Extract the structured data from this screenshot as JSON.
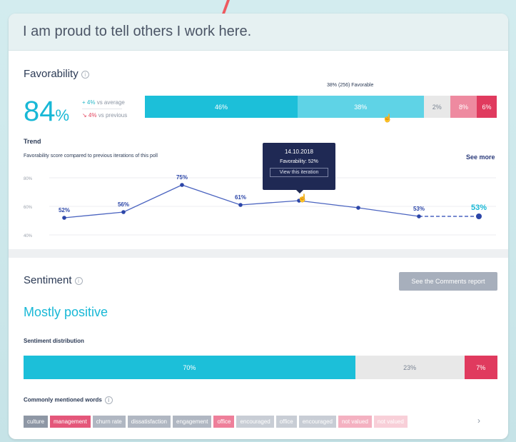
{
  "question": "I am proud to tell others I work here.",
  "favorability": {
    "title": "Favorability",
    "score": "84",
    "score_unit": "%",
    "vs_average": "+ 4%",
    "vs_average_label": "vs average",
    "vs_previous": "↘ 4%",
    "vs_previous_label": "vs previous",
    "bar_caption": "38% (256) Favorable",
    "segments": [
      {
        "label": "46%",
        "value": 46,
        "color": "#1cbfd9"
      },
      {
        "label": "38%",
        "value": 38,
        "color": "#5fd3e6"
      },
      {
        "label": "2%",
        "value": 8,
        "color": "#e8e8e8"
      },
      {
        "label": "8%",
        "value": 8,
        "color": "#ee8aa0"
      },
      {
        "label": "6%",
        "value": 6,
        "color": "#e03a5e"
      }
    ]
  },
  "trend": {
    "title": "Trend",
    "subtitle": "Favorability score compared to previous iterations of this poll",
    "see_more": "See more",
    "tooltip": {
      "date": "14.10.2018",
      "value": "Favorability: 52%",
      "action": "View this iteration"
    }
  },
  "chart_data": {
    "type": "line",
    "ylim": [
      35,
      85
    ],
    "yticks": [
      "80%",
      "60%",
      "40%"
    ],
    "ytick_values": [
      80,
      60,
      40
    ],
    "x": [
      0,
      1,
      2,
      3,
      4,
      5,
      6,
      7
    ],
    "values": [
      52,
      56,
      75,
      61,
      64,
      59,
      53,
      53
    ],
    "point_labels": [
      "52%",
      "56%",
      "75%",
      "61%",
      "",
      "",
      "53%",
      "53%"
    ],
    "projected_last": true,
    "line_color": "#4b64c0"
  },
  "sentiment": {
    "title": "Sentiment",
    "comments_button": "See the Comments report",
    "summary": "Mostly positive",
    "distribution_title": "Sentiment distribution",
    "segments": [
      {
        "label": "70%",
        "value": 70,
        "color": "#1cbfd9",
        "text_color": "#ffffff"
      },
      {
        "label": "23%",
        "value": 23,
        "color": "#e8e8e8",
        "text_color": "#7b8594"
      },
      {
        "label": "7%",
        "value": 7,
        "color": "#e03a5e",
        "text_color": "#ffffff"
      }
    ],
    "words_title": "Commonly mentioned words",
    "words": [
      {
        "text": "culture",
        "color": "#8e97a5"
      },
      {
        "text": "management",
        "color": "#e4577a"
      },
      {
        "text": "churn rate",
        "color": "#b0b7c2"
      },
      {
        "text": "dissatisfaction",
        "color": "#b0b7c2"
      },
      {
        "text": "engagement",
        "color": "#b0b7c2"
      },
      {
        "text": "office",
        "color": "#ee7f9a"
      },
      {
        "text": "encouraged",
        "color": "#c8cdd5"
      },
      {
        "text": "office",
        "color": "#c8cdd5"
      },
      {
        "text": "encouraged",
        "color": "#c8cdd5"
      },
      {
        "text": "not valued",
        "color": "#f4b1c1"
      },
      {
        "text": "not valued",
        "color": "#f8cfd8"
      }
    ]
  }
}
